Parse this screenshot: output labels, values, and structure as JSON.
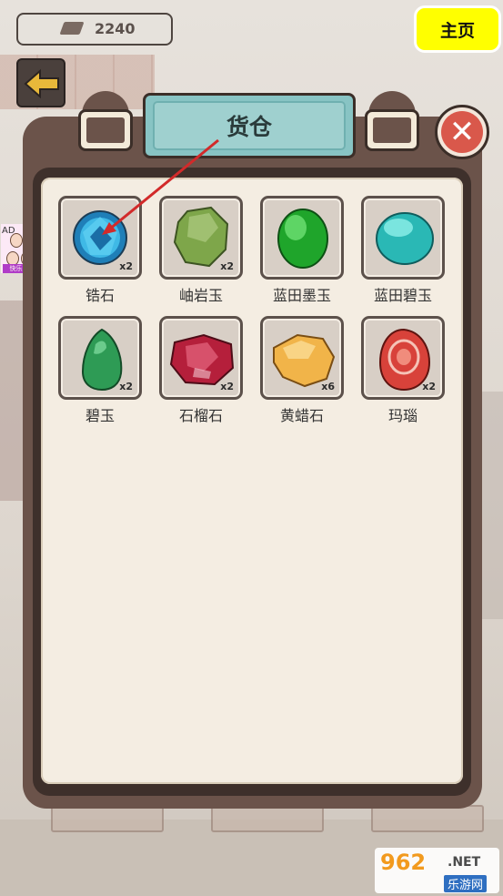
{
  "hud": {
    "currency_value": "2240",
    "currency_icon": "brick-icon",
    "home_label": "主页",
    "back_icon": "back-arrow-icon"
  },
  "ad": {
    "label": "AD",
    "banner": "快乐方块屋"
  },
  "inventory": {
    "title": "货仓",
    "close_icon": "close-icon",
    "items": [
      {
        "name": "锆石",
        "qty": "x2",
        "icon": "zircon-gem-icon",
        "color": "#2aa6d8"
      },
      {
        "name": "岫岩玉",
        "qty": "x2",
        "icon": "xiuyan-jade-icon",
        "color": "#7da24a"
      },
      {
        "name": "蓝田墨玉",
        "qty": "",
        "icon": "lantian-black-jade-icon",
        "color": "#22b52f"
      },
      {
        "name": "蓝田碧玉",
        "qty": "",
        "icon": "lantian-jasper-icon",
        "color": "#37c6c2"
      },
      {
        "name": "碧玉",
        "qty": "x2",
        "icon": "jasper-icon",
        "color": "#2f9b56"
      },
      {
        "name": "石榴石",
        "qty": "x2",
        "icon": "garnet-icon",
        "color": "#b5233f"
      },
      {
        "name": "黄蜡石",
        "qty": "x6",
        "icon": "yellow-wax-stone-icon",
        "color": "#f0b54a"
      },
      {
        "name": "玛瑙",
        "qty": "x2",
        "icon": "agate-icon",
        "color": "#d8433b"
      }
    ]
  },
  "watermark": {
    "main": "962",
    "suffix": ".NET",
    "sub": "乐游网"
  }
}
